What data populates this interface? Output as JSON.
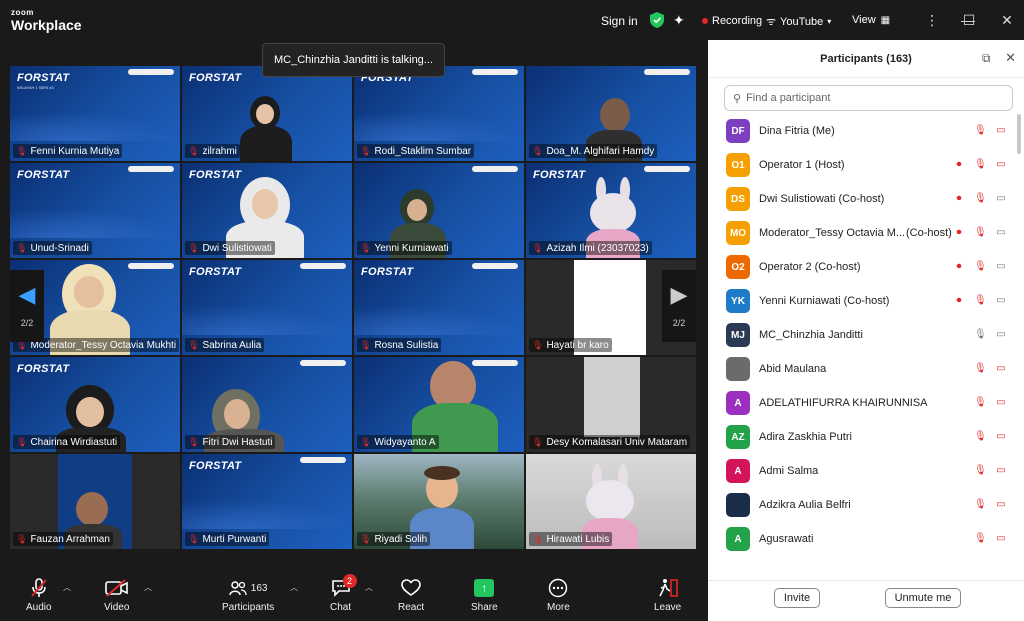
{
  "app": {
    "logo_top": "zoom",
    "logo_bottom": "Workplace"
  },
  "topbar": {
    "sign_in": "Sign in",
    "recording": "Recording",
    "youtube": "YouTube",
    "view": "View"
  },
  "toast": "MC_Chinzhia Janditti is talking...",
  "slide": {
    "title": "FORSTAT",
    "subtitle": "WILAYAH 1 SERI #3"
  },
  "tiles": [
    {
      "name": "Fenni Kurnia Mutiya"
    },
    {
      "name": "zilrahmi"
    },
    {
      "name": "Rodi_Staklim Sumbar"
    },
    {
      "name": "Doa_M. Alghifari Hamdy"
    },
    {
      "name": "Unud-Srinadi"
    },
    {
      "name": "Dwi Sulistiowati"
    },
    {
      "name": "Yenni Kurniawati"
    },
    {
      "name": "Azizah Ilmi (23037023)"
    },
    {
      "name": "Moderator_Tessy Octavia Mukhti"
    },
    {
      "name": "Sabrina Aulia"
    },
    {
      "name": "Rosna Sulistia"
    },
    {
      "name": "Hayati br karo"
    },
    {
      "name": "Chairina Wirdiastuti"
    },
    {
      "name": "Fitri Dwi Hastuti"
    },
    {
      "name": "Widyayanto A"
    },
    {
      "name": "Desy Komalasari Univ Mataram"
    },
    {
      "name": "Fauzan Arrahman"
    },
    {
      "name": "Murti Purwanti"
    },
    {
      "name": "Riyadi Solih"
    },
    {
      "name": "Hirawati Lubis"
    }
  ],
  "pager": {
    "left": "2/2",
    "right": "2/2"
  },
  "toolbar": {
    "audio": "Audio",
    "video": "Video",
    "participants": "Participants",
    "participants_count": "163",
    "chat": "Chat",
    "chat_badge": "2",
    "react": "React",
    "share": "Share",
    "more": "More",
    "leave": "Leave"
  },
  "panel": {
    "title": "Participants (163)",
    "search_placeholder": "Find a participant",
    "invite": "Invite",
    "unmute_me": "Unmute me",
    "participants": [
      {
        "initials": "DF",
        "name": "Dina Fitria (Me)",
        "role": "",
        "color": "#7b3fbf"
      },
      {
        "initials": "O1",
        "name": "Operator 1 (Host)",
        "role": "",
        "color": "#f5a000"
      },
      {
        "initials": "DS",
        "name": "Dwi Sulistiowati (Co-host)",
        "role": "",
        "color": "#f5a000"
      },
      {
        "initials": "MO",
        "name": "Moderator_Tessy Octavia M...",
        "role": "(Co-host)",
        "color": "#f5a000"
      },
      {
        "initials": "O2",
        "name": "Operator 2 (Co-host)",
        "role": "",
        "color": "#ee6a00"
      },
      {
        "initials": "YK",
        "name": "Yenni Kurniawati (Co-host)",
        "role": "",
        "color": "#1f7ac8"
      },
      {
        "initials": "MJ",
        "name": "MC_Chinzhia Janditti",
        "role": "",
        "color": "#2a3a55"
      },
      {
        "initials": "",
        "name": "Abid Maulana",
        "role": "",
        "color": "#6b6b6b"
      },
      {
        "initials": "A",
        "name": "ADELATHIFURRA KHAIRUNNISA",
        "role": "",
        "color": "#9b2fbf"
      },
      {
        "initials": "AZ",
        "name": "Adira Zaskhia Putri",
        "role": "",
        "color": "#22a34a"
      },
      {
        "initials": "A",
        "name": "Admi Salma",
        "role": "",
        "color": "#d4145a"
      },
      {
        "initials": "",
        "name": "Adzikra Aulia Belfri",
        "role": "",
        "color": "#1b2b4a"
      },
      {
        "initials": "A",
        "name": "Agusrawati",
        "role": "",
        "color": "#22a34a"
      }
    ]
  }
}
